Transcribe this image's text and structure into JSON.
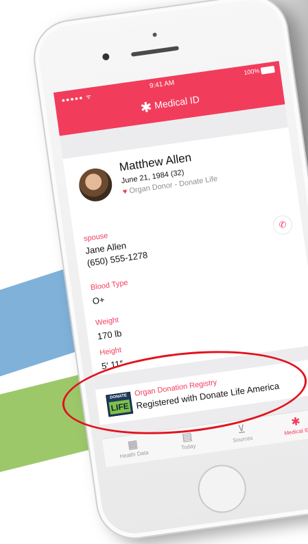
{
  "status": {
    "signal": "●●●●● ᯤ",
    "time": "9:41 AM",
    "battery": "100%"
  },
  "nav": {
    "title": "Medical ID",
    "title_icon": "asterisk-icon"
  },
  "profile": {
    "name": "Matthew Allen",
    "dob": "June 21, 1984 (32)",
    "donor_status": "Organ Donor - Donate Life"
  },
  "contact": {
    "relationship": "spouse",
    "name": "Jane Allen",
    "phone": "(650) 555-1278"
  },
  "blood_type": {
    "label": "Blood Type",
    "value": "O+"
  },
  "weight": {
    "label": "Weight",
    "value": "170 lb"
  },
  "height": {
    "label": "Height",
    "value": "5′ 11″"
  },
  "registry": {
    "title": "Organ Donation Registry",
    "subtitle": "Registered with Donate Life America",
    "logo_top": "DONATE",
    "logo_bottom": "LIFE"
  },
  "tabs": [
    {
      "label": "Health Data",
      "icon": "grid-icon"
    },
    {
      "label": "Today",
      "icon": "calendar-icon"
    },
    {
      "label": "Sources",
      "icon": "download-icon"
    },
    {
      "label": "Medical ID",
      "icon": "asterisk-icon"
    }
  ],
  "colors": {
    "accent": "#f23c5c",
    "highlight_oval": "#e3121c",
    "background_blue": "#7fb1d9",
    "background_green": "#9dc86a"
  }
}
